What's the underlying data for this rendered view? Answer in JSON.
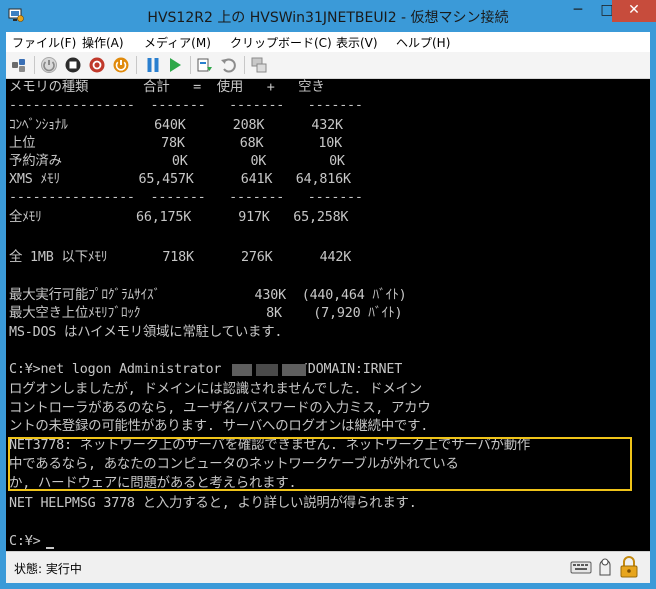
{
  "window": {
    "title": "HVS12R2 上の HVSWin31JNETBEUI2 - 仮想マシン接続",
    "minimize": "─",
    "maximize": "□",
    "close": "✕"
  },
  "menu": [
    "ファイル(F)",
    "操作(A)",
    "メディア(M)",
    "クリップボード(C)",
    "表示(V)",
    "ヘルプ(H)"
  ],
  "toolbar_icons": [
    "ctrl-alt-del-icon",
    "start-icon",
    "turn-off-icon",
    "shutdown-icon",
    "power-icon",
    "pause-icon",
    "resume-icon",
    "checkpoint-icon",
    "revert-icon",
    "enhanced-session-icon"
  ],
  "console": {
    "lines": [
      "メモリの種類       合計   =  使用   +   空き",
      "----------------  -------   -------   -------",
      "ｺﾝﾍﾞﾝｼｮﾅﾙ           640K      208K      432K",
      "上位                78K       68K       10K",
      "予約済み              0K        0K        0K",
      "XMS ﾒﾓﾘ          65,457K      641K   64,816K",
      "----------------  -------   -------   -------",
      "全ﾒﾓﾘ            66,175K      917K   65,258K",
      "",
      "全 1MB 以下ﾒﾓﾘ       718K      276K      442K",
      "",
      "最大実行可能ﾌﾟﾛｸﾞﾗﾑｻｲｽﾞ            430K  (440,464 ﾊﾞｲﾄ)",
      "最大空き上位ﾒﾓﾘﾌﾞﾛｯｸ                8K    (7,920 ﾊﾞｲﾄ)",
      "MS-DOS はハイメモリ領域に常駐しています.",
      "",
      "C:¥>net logon Administrator          /DOMAIN:IRNET",
      "ログオンしましたが, ドメインには認識されませんでした. ドメイン",
      "コントローラがあるのなら, ユーザ名/パスワードの入力ミス, アカウ",
      "ントの未登録の可能性があります. サーバへのログオンは継続中です.",
      "NET3778: ネットワーク上のサーバを確認できません. ネットワーク上でサーバが動作",
      "中であるなら, あなたのコンピュータのネットワークケーブルが外れている",
      "か, ハードウェアに問題があると考えられます.",
      "NET HELPMSG 3778 と入力すると, より詳しい説明が得られます.",
      "",
      "C:¥>"
    ]
  },
  "status": {
    "text": "状態: 実行中"
  }
}
